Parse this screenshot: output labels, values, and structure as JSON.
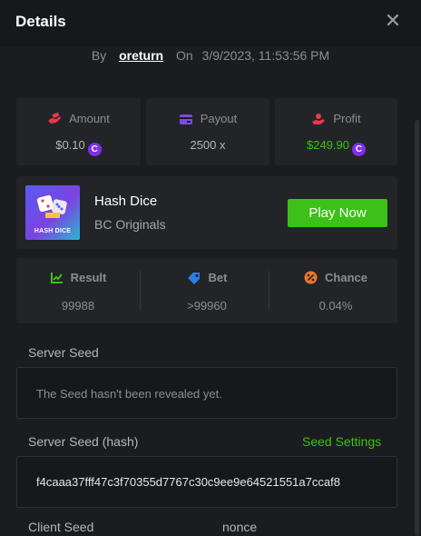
{
  "header": {
    "title": "Details",
    "close_icon": "close-icon"
  },
  "meta": {
    "by_label": "By",
    "username": "oreturn",
    "on_label": "On",
    "datetime": "3/9/2023, 11:53:56 PM"
  },
  "stats": {
    "amount": {
      "label": "Amount",
      "value": "$0.10",
      "icon": "amount-hand-icon",
      "coin": "C"
    },
    "payout": {
      "label": "Payout",
      "value": "2500 x",
      "icon": "payout-card-icon"
    },
    "profit": {
      "label": "Profit",
      "value": "$249.90",
      "icon": "profit-hand-icon",
      "coin": "C"
    }
  },
  "game": {
    "name": "Hash Dice",
    "provider": "BC Originals",
    "thumbnail_text": "HASH DICE",
    "play_label": "Play Now"
  },
  "result": {
    "result": {
      "label": "Result",
      "value": "99988",
      "icon": "result-chart-icon"
    },
    "bet": {
      "label": "Bet",
      "value": ">99960",
      "icon": "bet-tag-icon"
    },
    "chance": {
      "label": "Chance",
      "value": "0.04%",
      "icon": "chance-percent-icon"
    }
  },
  "server_seed": {
    "label": "Server Seed",
    "value": "The Seed hasn't been revealed yet."
  },
  "server_seed_hash": {
    "label": "Server Seed (hash)",
    "settings_label": "Seed Settings",
    "value": "f4caaa37fff47c3f70355d7767c30c9ee9e64521551a7ccaf8"
  },
  "client_seed": {
    "label": "Client Seed",
    "nonce_label": "nonce"
  },
  "colors": {
    "accent_green": "#3bc117",
    "coin_purple": "#7e2ff0",
    "background": "#1b1c1f"
  }
}
